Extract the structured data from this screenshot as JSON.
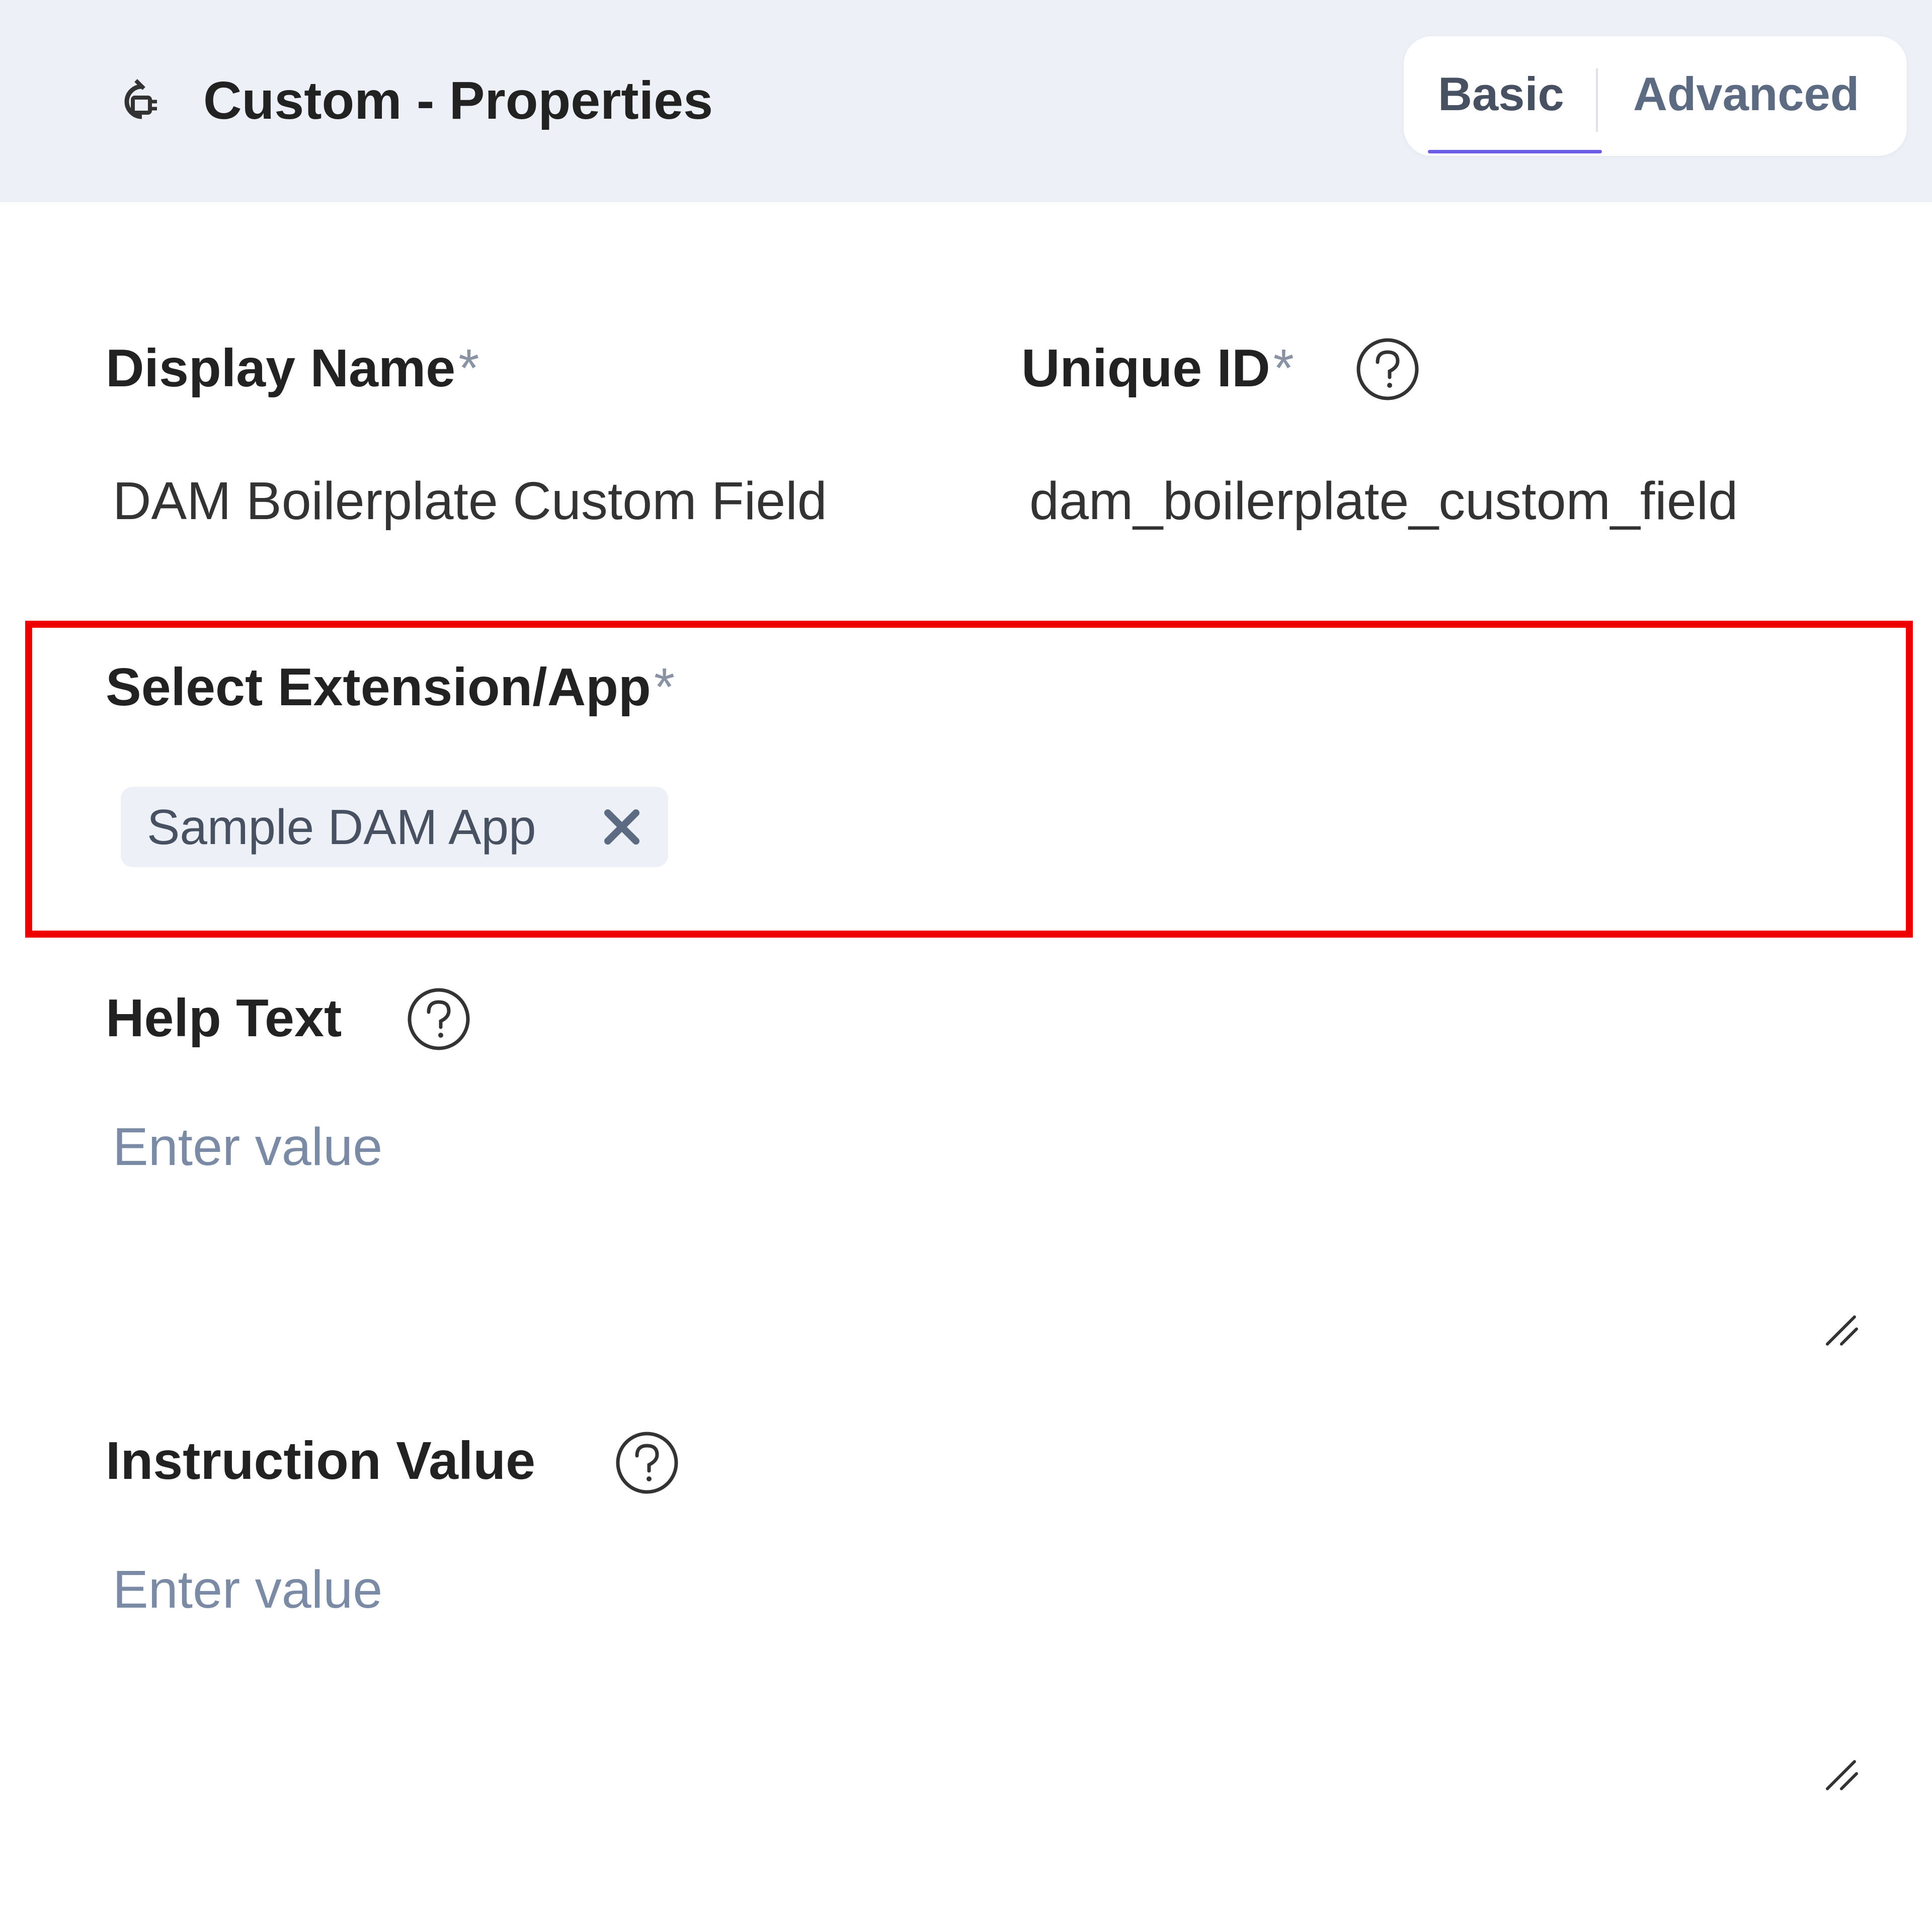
{
  "header": {
    "icon": "custom-field-icon",
    "title": "Custom - Properties",
    "tabs": [
      {
        "label": "Basic",
        "active": true
      },
      {
        "label": "Advanced",
        "active": false
      }
    ]
  },
  "fields": {
    "display_name": {
      "label": "Display Name",
      "required_mark": "*",
      "value": "DAM Boilerplate Custom Field"
    },
    "unique_id": {
      "label": "Unique ID",
      "required_mark": "*",
      "help_icon": "question-circle-icon",
      "value": "dam_boilerplate_custom_field"
    },
    "extension": {
      "label": "Select Extension/App",
      "required_mark": "*",
      "selected": [
        {
          "label": "Sample DAM App",
          "remove_icon": "close-icon"
        }
      ]
    },
    "help_text": {
      "label": "Help Text",
      "help_icon": "question-circle-icon",
      "placeholder": "Enter value"
    },
    "instruction_value": {
      "label": "Instruction Value",
      "help_icon": "question-circle-icon",
      "placeholder": "Enter value"
    }
  },
  "colors": {
    "header_bg": "#edf0f7",
    "highlight": "#ee0000",
    "tab_underline": "#6c5ce7",
    "placeholder": "#7b8aa5"
  }
}
